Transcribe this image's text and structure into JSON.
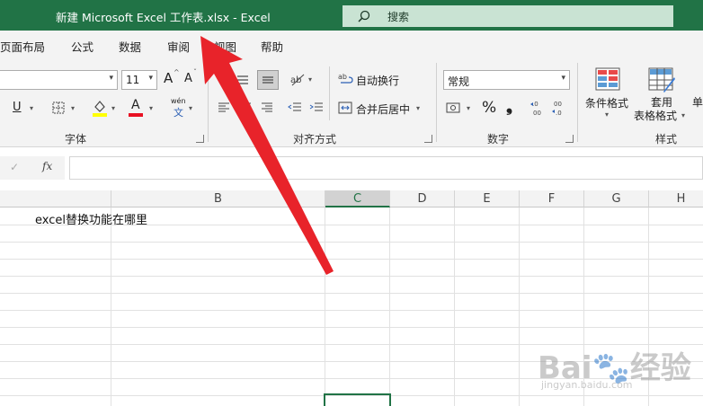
{
  "window": {
    "title": "新建 Microsoft Excel 工作表.xlsx  -  Excel"
  },
  "search": {
    "label": "搜索"
  },
  "menu": {
    "tabs": [
      "页面布局",
      "公式",
      "数据",
      "审阅",
      "视图",
      "帮助"
    ]
  },
  "ribbon": {
    "font": {
      "size_value": "11",
      "grow_label": "A",
      "shrink_label": "A",
      "underline_label": "U",
      "fontcolor_label": "A",
      "phonetic_label": "wén",
      "phonetic_char": "文",
      "group_label": "字体"
    },
    "alignment": {
      "wrap_label": "自动换行",
      "merge_label": "合并后居中",
      "group_label": "对齐方式"
    },
    "number": {
      "format_value": "常规",
      "percent_label": "%",
      "comma_label": "❟",
      "group_label": "数字"
    },
    "styles": {
      "conditional_label": "条件格式",
      "table_label_1": "套用",
      "table_label_2": "表格格式",
      "cell_label": "单",
      "group_label": "样式"
    }
  },
  "formula_bar": {
    "check": "✓",
    "fx": "fx",
    "value": ""
  },
  "sheet": {
    "columns": [
      "B",
      "C",
      "D",
      "E",
      "F",
      "G",
      "H"
    ],
    "selected_column": "C",
    "cell_text": "excel替换功能在哪里"
  },
  "watermark": {
    "text": "Bai🐾经验",
    "sub": "jingyan.baidu.com"
  },
  "colors": {
    "excel_green": "#217346",
    "arrow_red": "#e8232a"
  }
}
